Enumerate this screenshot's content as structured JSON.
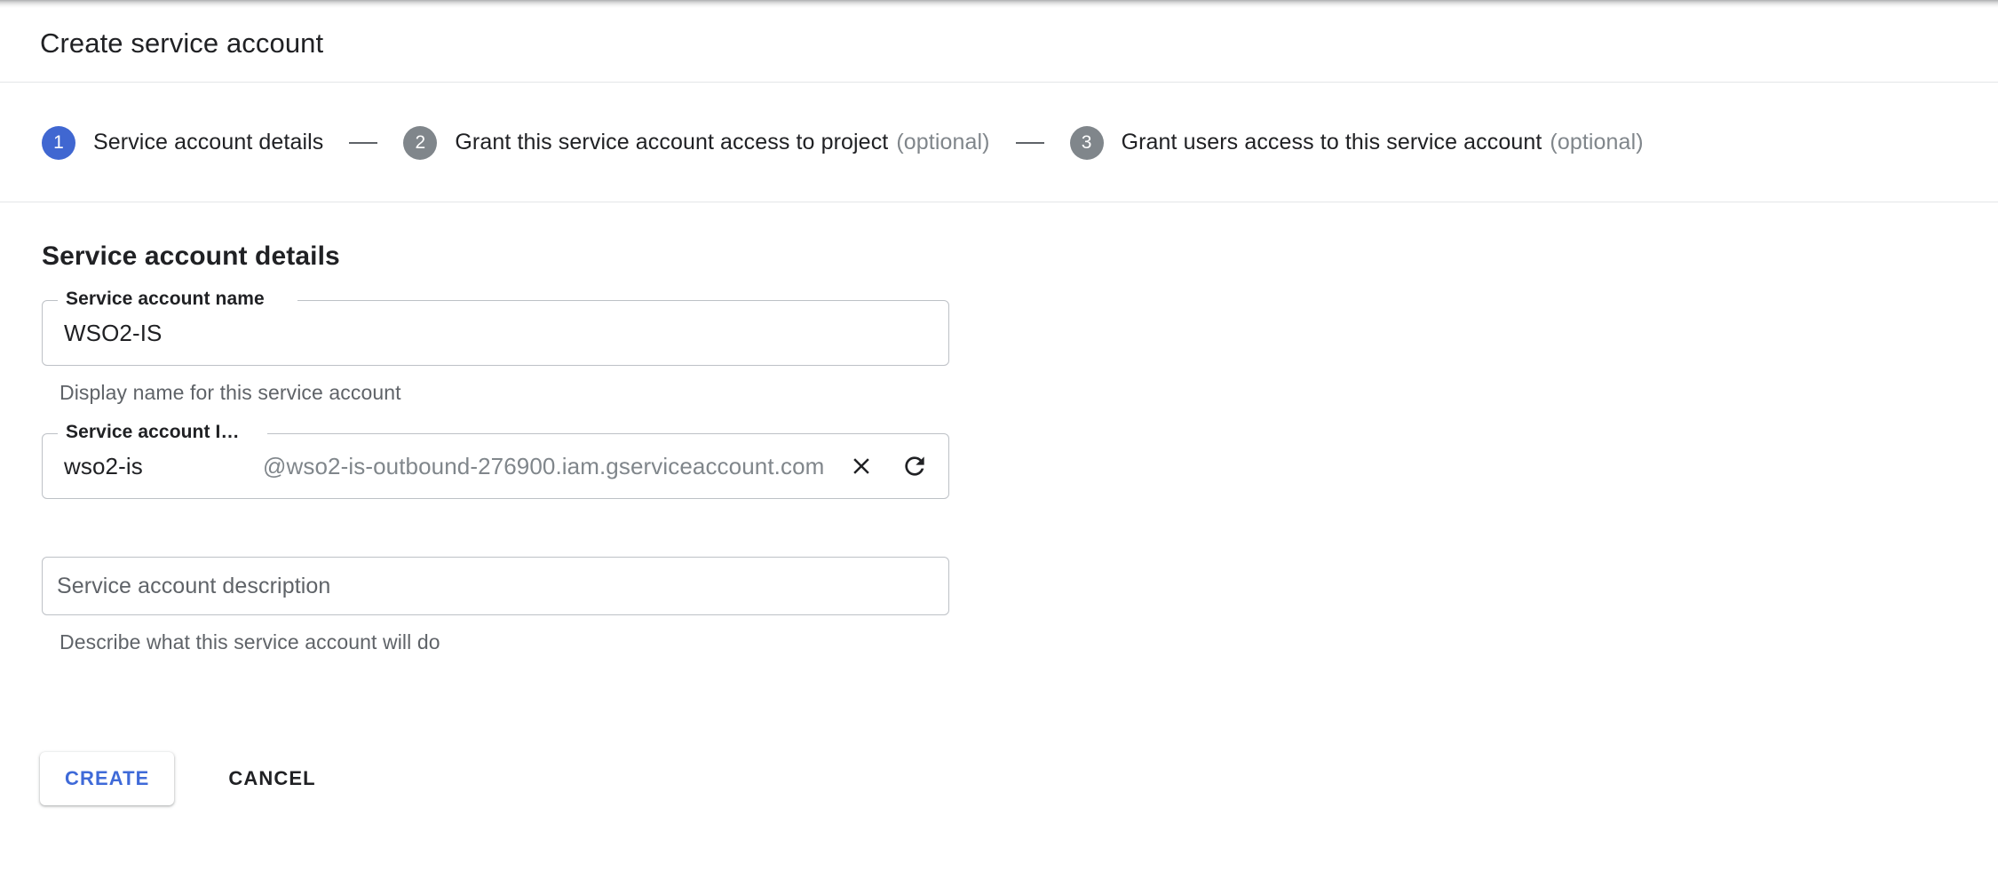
{
  "header": {
    "title": "Create service account"
  },
  "stepper": {
    "separator": "—",
    "steps": [
      {
        "number": "1",
        "label": "Service account details",
        "optional": "",
        "state": "active"
      },
      {
        "number": "2",
        "label": "Grant this service account access to project",
        "optional": "(optional)",
        "state": "inactive"
      },
      {
        "number": "3",
        "label": "Grant users access to this service account",
        "optional": "(optional)",
        "state": "inactive"
      }
    ]
  },
  "main": {
    "section_title": "Service account details",
    "name_field": {
      "label": "Service account name",
      "value": "WSO2-IS",
      "placeholder": "",
      "helper": "Display name for this service account"
    },
    "id_field": {
      "label": "Service account I…",
      "value": "wso2-is",
      "placeholder": "",
      "suffix": "@wso2-is-outbound-276900.iam.gserviceaccount.com",
      "clear_icon": "close-icon",
      "refresh_icon": "refresh-icon"
    },
    "description_field": {
      "value": "",
      "placeholder": "Service account description",
      "helper": "Describe what this service account will do"
    }
  },
  "actions": {
    "create_label": "CREATE",
    "cancel_label": "CANCEL"
  },
  "colors": {
    "accent_blue": "#4067d1",
    "button_blue": "#3f6ad8",
    "step_inactive_gray": "#80868b",
    "text_primary": "#202124",
    "text_secondary": "#5f6368",
    "border_gray": "#bdc1c6",
    "divider_gray": "#e4e6e8"
  }
}
